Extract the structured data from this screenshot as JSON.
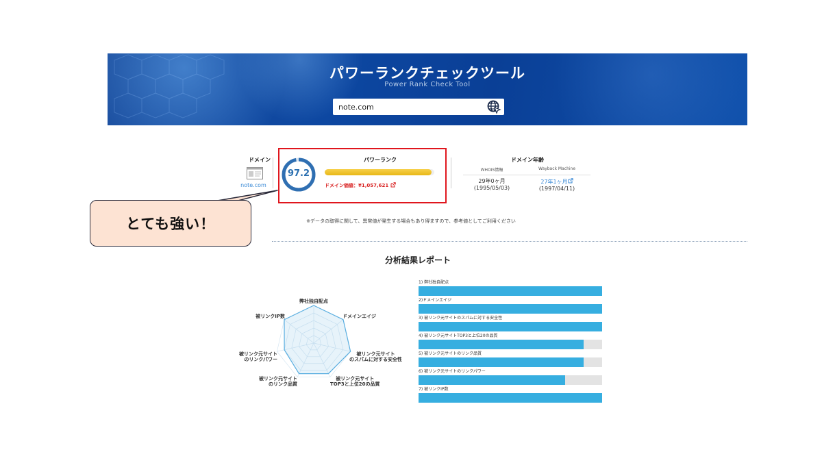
{
  "header": {
    "title": "パワーランクチェックツール",
    "subtitle": "Power Rank Check Tool",
    "search_value": "note.com",
    "search_icon": "globe-cursor-icon"
  },
  "result": {
    "domain_label": "ドメイン",
    "domain_name": "note.com",
    "power_rank_label": "パワーランク",
    "power_rank_score": "97.2",
    "power_rank_fraction": 0.972,
    "domain_value": "ドメイン価値：¥1,057,621",
    "domain_age_label": "ドメイン年齢",
    "whois_label": "WHOIS情報",
    "wayback_label": "Wayback Machine",
    "whois_age": "29年0ヶ月",
    "whois_date": "(1995/05/03)",
    "wayback_age": "27年1ヶ月",
    "wayback_date": "(1997/04/11)"
  },
  "callout": {
    "text": "とても強い！"
  },
  "note": "※データの取得に関して、異常値が発生する場合もあり得ますので、参考値としてご利用ください",
  "report": {
    "title": "分析結果レポート",
    "radar_labels": [
      "弊社独自配点",
      "ドメインエイジ",
      "被リンク元サイト\nのスパムに対する安全性",
      "被リンク元サイト\nTOP3と上位20の品質",
      "被リンク元サイト\nのリンク品質",
      "被リンク元サイト\nのリンクパワー",
      "被リンクIP数"
    ],
    "bars": [
      {
        "label": "1) 弊社独自配点",
        "value": 1.0
      },
      {
        "label": "2)ドメインエイジ",
        "value": 1.0
      },
      {
        "label": "3) 被リンク元サイトのスパムに対する安全性",
        "value": 1.0
      },
      {
        "label": "4) 被リンク元サイトTOP3と上位20の品質",
        "value": 0.9
      },
      {
        "label": "5) 被リンク元サイトのリンク品質",
        "value": 0.9
      },
      {
        "label": "6) 被リンク元サイトのリンクパワー",
        "value": 0.8
      },
      {
        "label": "7) 被リンクIP数",
        "value": 1.0
      }
    ]
  }
}
